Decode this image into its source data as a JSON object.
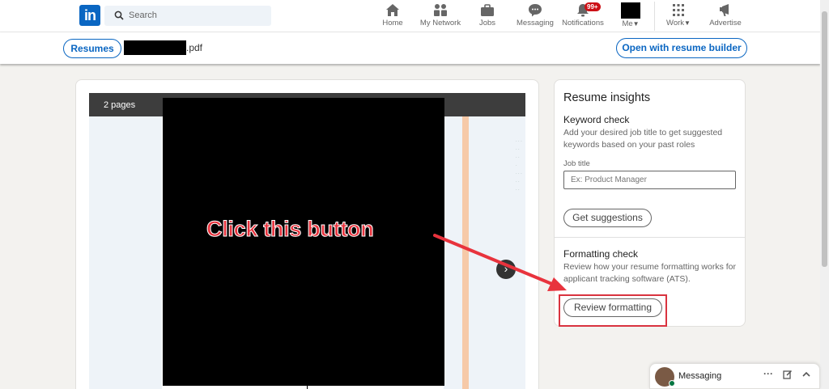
{
  "nav": {
    "logo": "in",
    "search_placeholder": "Search",
    "items": [
      {
        "label": "Home",
        "icon": "home-icon"
      },
      {
        "label": "My Network",
        "icon": "network-icon"
      },
      {
        "label": "Jobs",
        "icon": "briefcase-icon"
      },
      {
        "label": "Messaging",
        "icon": "chat-icon"
      },
      {
        "label": "Notifications",
        "icon": "bell-icon",
        "badge": "99+"
      },
      {
        "label": "Me",
        "icon": "avatar"
      },
      {
        "label": "Work",
        "icon": "grid-icon"
      },
      {
        "label": "Advertise",
        "icon": "advertise-icon"
      }
    ]
  },
  "subheader": {
    "resumes_label": "Resumes",
    "file_ext": ".pdf",
    "open_builder_label": "Open with resume builder"
  },
  "preview": {
    "pages_label": "2 pages",
    "next_glyph": "›"
  },
  "insights": {
    "title": "Resume insights",
    "keyword_title": "Keyword check",
    "keyword_desc": "Add your desired job title to get suggested keywords based on your past roles",
    "job_title_label": "Job title",
    "job_title_placeholder": "Ex: Product Manager",
    "get_suggestions_label": "Get suggestions",
    "formatting_title": "Formatting check",
    "formatting_desc": "Review how your resume formatting works for applicant tracking software (ATS).",
    "review_label": "Review formatting"
  },
  "annotation": {
    "text": "Click this button",
    "color": "#e8333d"
  },
  "messaging_dock": {
    "label": "Messaging",
    "more": "···"
  },
  "colors": {
    "brand": "#0a66c2",
    "notification_badge": "#cc1016",
    "page_bg": "#f3f2ef"
  }
}
